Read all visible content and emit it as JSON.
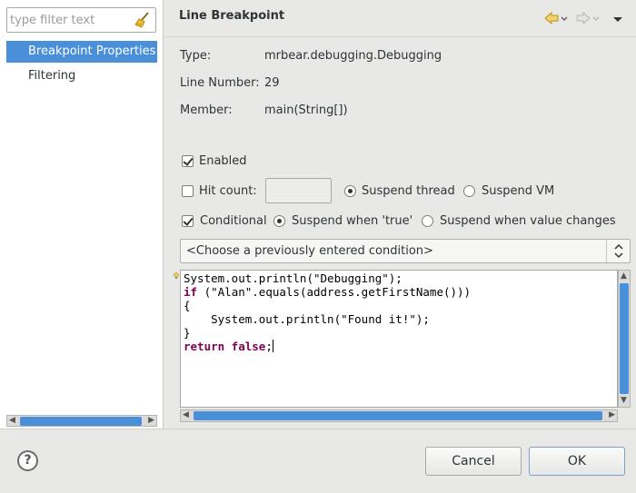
{
  "filter": {
    "placeholder": "type filter text"
  },
  "nav": {
    "items": [
      {
        "label": "Breakpoint Properties",
        "selected": true
      },
      {
        "label": "Filtering",
        "selected": false
      }
    ]
  },
  "page": {
    "title": "Line Breakpoint",
    "info": [
      {
        "label": "Type:",
        "value": "mrbear.debugging.Debugging"
      },
      {
        "label": "Line Number:",
        "value": "29"
      },
      {
        "label": "Member:",
        "value": "main(String[])"
      }
    ]
  },
  "options": {
    "enabled": {
      "label": "Enabled",
      "checked": true
    },
    "hit_count": {
      "label": "Hit count:",
      "checked": false,
      "value": ""
    },
    "suspend_thread": {
      "label": "Suspend thread",
      "selected": true
    },
    "suspend_vm": {
      "label": "Suspend VM",
      "selected": false
    },
    "conditional": {
      "label": "Conditional",
      "checked": true
    },
    "suspend_true": {
      "label": "Suspend when 'true'",
      "selected": true
    },
    "suspend_changes": {
      "label": "Suspend when value changes",
      "selected": false
    }
  },
  "condition": {
    "select_value": "<Choose a previously entered condition>",
    "code_lines": [
      "System.out.println(\"Debugging\");",
      "if (\"Alan\".equals(address.getFirstName()))",
      "{",
      "    System.out.println(\"Found it!\");",
      "}",
      "return false;"
    ]
  },
  "buttons": {
    "help": "?",
    "cancel": "Cancel",
    "ok": "OK"
  },
  "colors": {
    "selection": "#4a90d9",
    "keyword": "#7f0055",
    "background": "#e8e8e7"
  }
}
